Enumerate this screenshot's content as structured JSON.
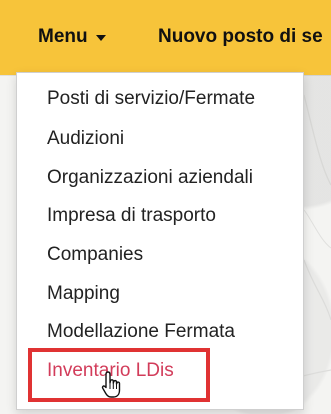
{
  "header": {
    "menu_label": "Menu",
    "nav_link_label": "Nuovo posto di se"
  },
  "dropdown": {
    "items": [
      {
        "label": "Posti di servizio/Fermate"
      },
      {
        "label": "Audizioni"
      },
      {
        "label": "Organizzazioni aziendali"
      },
      {
        "label": "Impresa di trasporto"
      },
      {
        "label": "Companies"
      },
      {
        "label": "Mapping"
      },
      {
        "label": "Modellazione Fermata"
      },
      {
        "label": "Inventario LDis"
      }
    ],
    "hovered_index": 7
  },
  "colors": {
    "header_background": "#f7c43a",
    "hover_text": "#d23c5a",
    "annotation_box": "#e03233"
  },
  "icons": {
    "menu_caret": "caret-down-icon",
    "cursor": "hand-pointer-icon"
  }
}
